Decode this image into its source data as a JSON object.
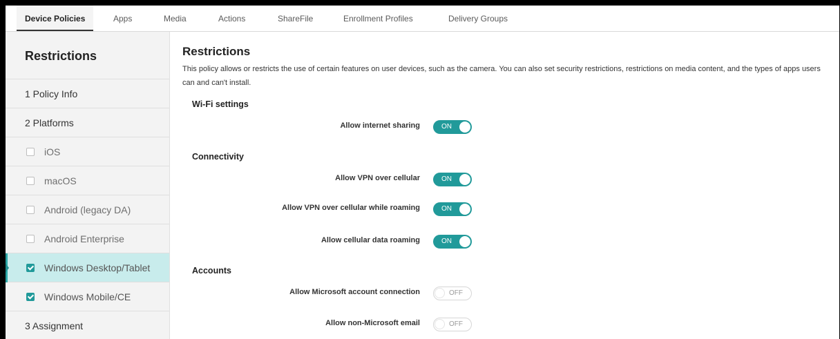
{
  "tabs": [
    {
      "label": "Device Policies",
      "active": true
    },
    {
      "label": "Apps"
    },
    {
      "label": "Media"
    },
    {
      "label": "Actions"
    },
    {
      "label": "ShareFile"
    },
    {
      "label": "Enrollment Profiles"
    },
    {
      "label": "Delivery Groups"
    }
  ],
  "sidebar": {
    "title": "Restrictions",
    "policy_info": "1 Policy Info",
    "platforms": "2 Platforms",
    "platform_items": [
      {
        "label": "iOS",
        "checked": false
      },
      {
        "label": "macOS",
        "checked": false
      },
      {
        "label": "Android (legacy DA)",
        "checked": false
      },
      {
        "label": "Android Enterprise",
        "checked": false
      },
      {
        "label": "Windows Desktop/Tablet",
        "checked": true,
        "selected": true
      },
      {
        "label": "Windows Mobile/CE",
        "checked": true
      }
    ],
    "assignment": "3 Assignment"
  },
  "main": {
    "title": "Restrictions",
    "description": "This policy allows or restricts the use of certain features on user devices, such as the camera. You can also set security restrictions, restrictions on media content, and the types of apps users can and can't install.",
    "sections": [
      {
        "title": "Wi-Fi settings",
        "settings": [
          {
            "label": "Allow internet sharing",
            "state": "ON"
          }
        ]
      },
      {
        "title": "Connectivity",
        "settings": [
          {
            "label": "Allow VPN over cellular",
            "state": "ON"
          },
          {
            "label": "Allow VPN over cellular while roaming",
            "state": "ON"
          },
          {
            "label": "Allow cellular data roaming",
            "state": "ON"
          }
        ]
      },
      {
        "title": "Accounts",
        "settings": [
          {
            "label": "Allow Microsoft account connection",
            "state": "OFF"
          },
          {
            "label": "Allow non-Microsoft email",
            "state": "OFF"
          }
        ]
      }
    ]
  },
  "colors": {
    "accent": "#219a9a",
    "selected_bg": "#c8ecec",
    "sidebar_bg": "#f3f3f3"
  }
}
